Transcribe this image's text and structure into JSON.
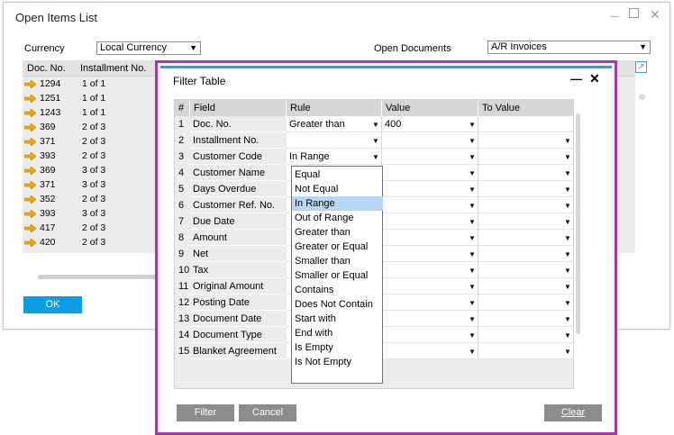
{
  "main_window": {
    "title": "Open Items List",
    "currency_label": "Currency",
    "currency_value": "Local Currency",
    "open_docs_label": "Open Documents",
    "open_docs_value": "A/R Invoices",
    "columns": [
      "Doc. No.",
      "Installment No."
    ],
    "rows": [
      {
        "doc": "1294",
        "inst": "1 of 1"
      },
      {
        "doc": "1251",
        "inst": "1 of 1"
      },
      {
        "doc": "1243",
        "inst": "1 of 1"
      },
      {
        "doc": "369",
        "inst": "2 of 3"
      },
      {
        "doc": "371",
        "inst": "2 of 3"
      },
      {
        "doc": "393",
        "inst": "2 of 3"
      },
      {
        "doc": "369",
        "inst": "3 of 3"
      },
      {
        "doc": "371",
        "inst": "3 of 3"
      },
      {
        "doc": "352",
        "inst": "2 of 3"
      },
      {
        "doc": "393",
        "inst": "3 of 3"
      },
      {
        "doc": "417",
        "inst": "2 of 3"
      },
      {
        "doc": "420",
        "inst": "2 of 3"
      }
    ],
    "ok_label": "OK"
  },
  "filter": {
    "title": "Filter Table",
    "headers": [
      "#",
      "Field",
      "Rule",
      "Value",
      "To Value"
    ],
    "rows": [
      {
        "n": "1",
        "field": "Doc. No.",
        "rule": "Greater than",
        "value": "400"
      },
      {
        "n": "2",
        "field": "Installment No.",
        "rule": "",
        "value": ""
      },
      {
        "n": "3",
        "field": "Customer Code",
        "rule": "In Range",
        "value": ""
      },
      {
        "n": "4",
        "field": "Customer Name",
        "rule": "",
        "value": ""
      },
      {
        "n": "5",
        "field": "Days Overdue",
        "rule": "",
        "value": ""
      },
      {
        "n": "6",
        "field": "Customer Ref. No.",
        "rule": "",
        "value": ""
      },
      {
        "n": "7",
        "field": "Due Date",
        "rule": "",
        "value": ""
      },
      {
        "n": "8",
        "field": "Amount",
        "rule": "",
        "value": ""
      },
      {
        "n": "9",
        "field": "Net",
        "rule": "",
        "value": ""
      },
      {
        "n": "10",
        "field": "Tax",
        "rule": "",
        "value": ""
      },
      {
        "n": "11",
        "field": "Original Amount",
        "rule": "",
        "value": ""
      },
      {
        "n": "12",
        "field": "Posting Date",
        "rule": "",
        "value": ""
      },
      {
        "n": "13",
        "field": "Document Date",
        "rule": "",
        "value": ""
      },
      {
        "n": "14",
        "field": "Document Type",
        "rule": "",
        "value": ""
      },
      {
        "n": "15",
        "field": "Blanket Agreement",
        "rule": "",
        "value": ""
      }
    ],
    "dropdown_options": [
      "Equal",
      "Not Equal",
      "In Range",
      "Out of Range",
      "Greater than",
      "Greater or Equal",
      "Smaller than",
      "Smaller or Equal",
      "Contains",
      "Does Not Contain",
      "Start with",
      "End with",
      "Is Empty",
      "Is Not Empty"
    ],
    "dropdown_selected": "In Range",
    "filter_label": "Filter",
    "cancel_label": "Cancel",
    "clear_label": "Clear"
  },
  "colors": {
    "accent": "#0a9ee6",
    "frame": "#9c3fa0",
    "highlight": "#b8d7f5"
  }
}
